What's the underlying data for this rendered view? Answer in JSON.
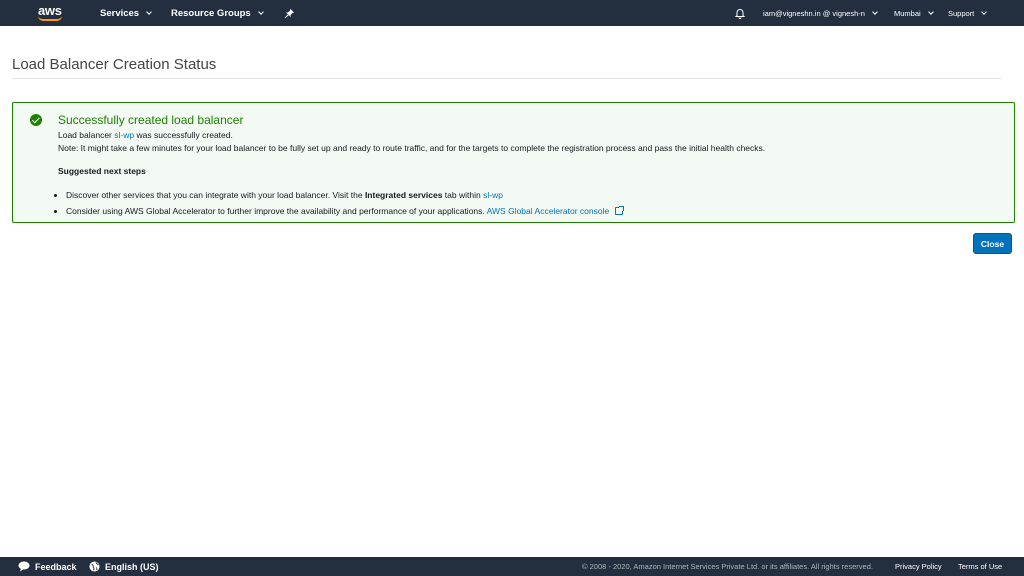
{
  "topnav": {
    "logo": "aws",
    "services": "Services",
    "resource_groups": "Resource Groups",
    "pin_icon": "pushpin-icon",
    "bell_icon": "bell-icon",
    "account": "iam@vigneshn.in @ vignesh-n",
    "region": "Mumbai",
    "support": "Support"
  },
  "page": {
    "title": "Load Balancer Creation Status"
  },
  "flash": {
    "title": "Successfully created load balancer",
    "lb_prefix": "Load balancer",
    "lb_name": "sl-wp",
    "lb_suffix": "was successfully created.",
    "note": "Note: It might take a few minutes for your load balancer to be fully set up and ready to route traffic, and for the targets to complete the registration process and pass the initial health checks.",
    "next_steps_heading": "Suggested next steps",
    "bullet1_prefix": "Discover other services that you can integrate with your load balancer. Visit the",
    "bullet1_bold": "Integrated services",
    "bullet1_mid": "tab within",
    "bullet1_link": "sl-wp",
    "bullet2_text": "Consider using AWS Global Accelerator to further improve the availability and performance of your applications.",
    "bullet2_link": "AWS Global Accelerator console"
  },
  "actions": {
    "close": "Close"
  },
  "footer": {
    "feedback": "Feedback",
    "language": "English (US)",
    "copyright": "© 2008 - 2020, Amazon Internet Services Private Ltd. or its affiliates. All rights reserved.",
    "privacy": "Privacy Policy",
    "terms": "Terms of Use"
  },
  "colors": {
    "nav_bg": "#232f3e",
    "success": "#1d8102",
    "link": "#0073bb",
    "accent": "#ff9900"
  }
}
